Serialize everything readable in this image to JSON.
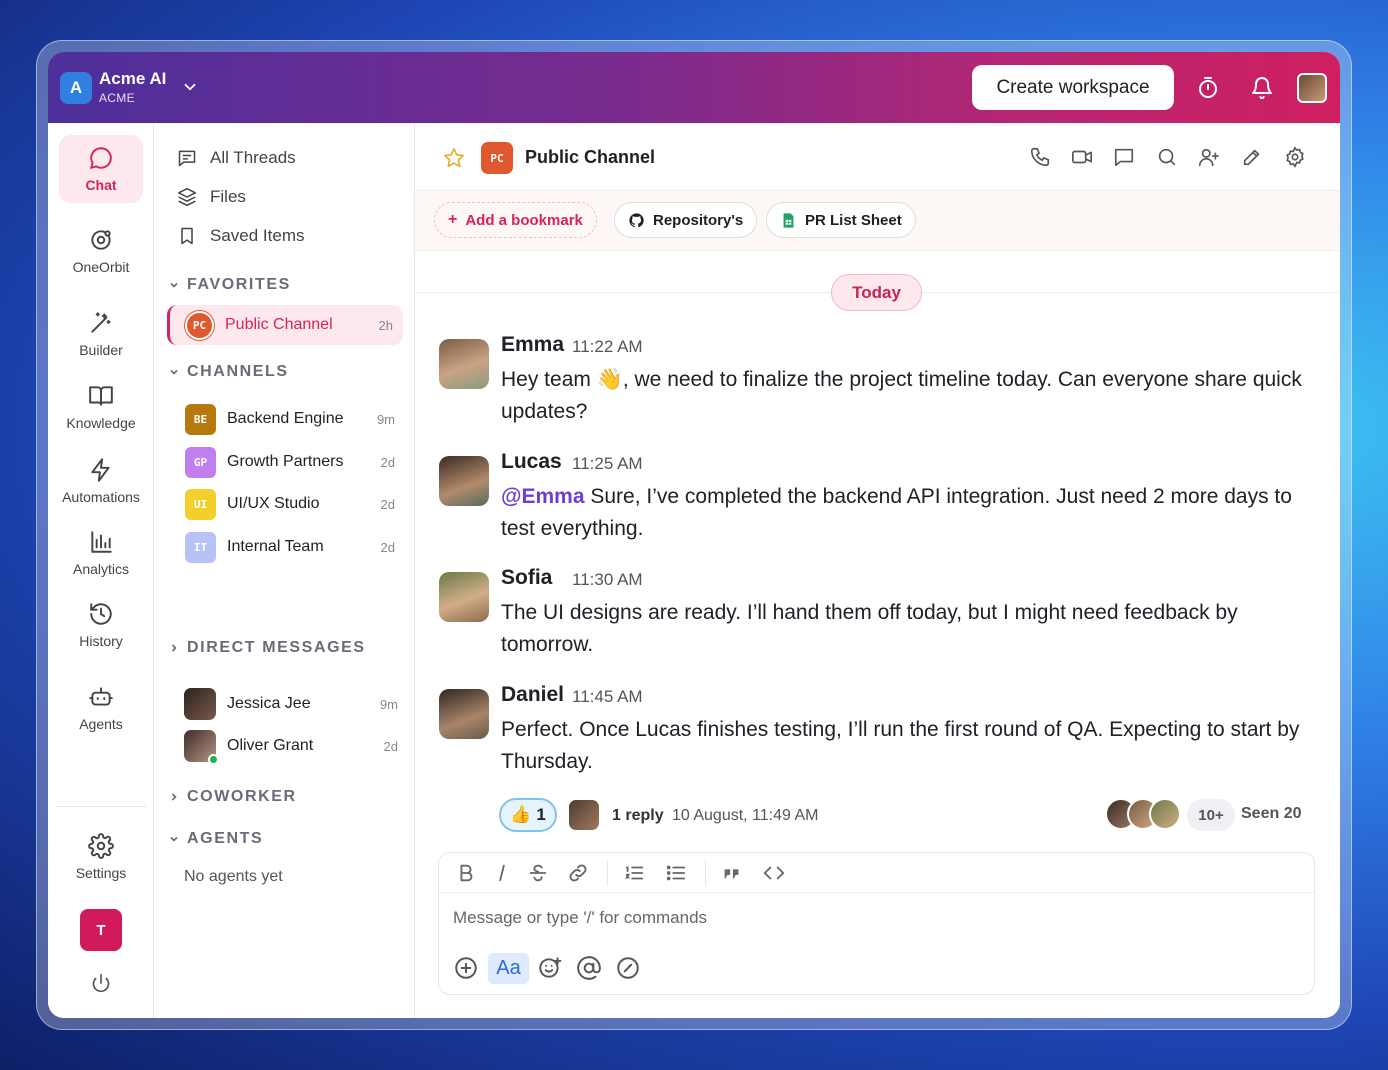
{
  "workspace": {
    "logo_letter": "A",
    "name": "Acme AI",
    "sub": "ACME"
  },
  "topbar": {
    "create_label": "Create workspace"
  },
  "rail": {
    "items": [
      {
        "label": "Chat",
        "icon": "chat-icon"
      },
      {
        "label": "OneOrbit",
        "icon": "orbit-icon"
      },
      {
        "label": "Builder",
        "icon": "magic-wand-icon"
      },
      {
        "label": "Knowledge",
        "icon": "book-icon"
      },
      {
        "label": "Automations",
        "icon": "lightning-icon"
      },
      {
        "label": "Analytics",
        "icon": "bar-chart-icon"
      },
      {
        "label": "History",
        "icon": "history-icon"
      },
      {
        "label": "Agents",
        "icon": "robot-icon"
      }
    ],
    "settings": "Settings",
    "user_initial": "T"
  },
  "panel": {
    "nav": [
      {
        "label": "All Threads",
        "icon": "threads-icon"
      },
      {
        "label": "Files",
        "icon": "layers-icon"
      },
      {
        "label": "Saved Items",
        "icon": "bookmark-icon"
      }
    ],
    "favorites_title": "FAVORITES",
    "favorite": {
      "badge": "PC",
      "name": "Public Channel",
      "time": "2h"
    },
    "channels_title": "CHANNELS",
    "channels": [
      {
        "badge": "BE",
        "name": "Backend Engine",
        "time": "9m",
        "color": "#b7780e"
      },
      {
        "badge": "GP",
        "name": "Growth Partners",
        "time": "2d",
        "color": "#c07ff0"
      },
      {
        "badge": "UI",
        "name": "UI/UX Studio",
        "time": "2d",
        "color": "#f2cf2a"
      },
      {
        "badge": "IT",
        "name": "Internal Team",
        "time": "2d",
        "color": "#b8c3f5"
      }
    ],
    "dm_title": "DIRECT MESSAGES",
    "dms": [
      {
        "name": "Jessica Jee",
        "time": "9m"
      },
      {
        "name": "Oliver Grant",
        "time": "2d"
      }
    ],
    "coworker_title": "COWORKER",
    "agents_title": "AGENTS",
    "no_agents": "No agents yet"
  },
  "channel": {
    "badge": "PC",
    "title": "Public Channel",
    "bookmarks": {
      "add": "Add a bookmark",
      "repo": "Repository's",
      "sheet": "PR List Sheet"
    }
  },
  "today_label": "Today",
  "messages": [
    {
      "author": "Emma",
      "time": "11:22 AM",
      "text": "Hey team 👋, we need to finalize the project timeline today. Can everyone share quick updates?"
    },
    {
      "author": "Lucas",
      "time": "11:25 AM",
      "mention": "@Emma",
      "text": " Sure, I’ve completed the backend API integration. Just need 2 more days to test everything."
    },
    {
      "author": "Sofia",
      "time": "11:30 AM",
      "text": "The UI designs are ready. I’ll hand them off today, but I might need feedback by tomorrow."
    },
    {
      "author": "Daniel",
      "time": "11:45 AM",
      "text": "Perfect. Once Lucas finishes testing, I’ll run the first round of QA. Expecting to start by Thursday."
    }
  ],
  "thread_meta": {
    "reaction_emoji": "👍",
    "reaction_count": "1",
    "reply": "1 reply",
    "reply_time": "10 August, 11:49 AM",
    "seen_more": "10+",
    "seen": "Seen 20"
  },
  "composer": {
    "placeholder": "Message or type '/' for commands",
    "aa_label": "Aa"
  },
  "colors": {
    "accent": "#d6245b",
    "mention": "#6b3fd4"
  }
}
